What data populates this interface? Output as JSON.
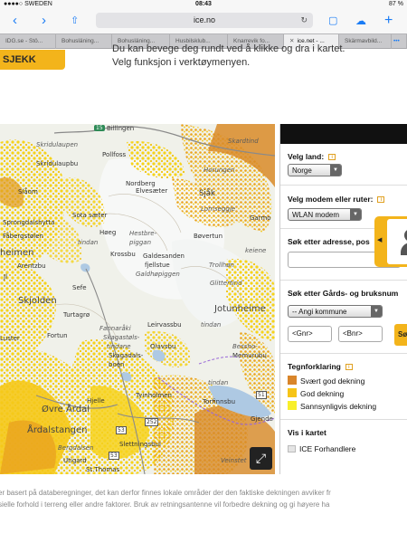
{
  "status_bar": {
    "carrier": "●●●●○ SWEDEN",
    "time": "08:43",
    "battery": "87 %"
  },
  "browser": {
    "url": "ice.no",
    "tabs": [
      {
        "label": "IDG.se - Stö...",
        "active": false
      },
      {
        "label": "Bohusläning...",
        "active": false
      },
      {
        "label": "Bohusläning...",
        "active": false
      },
      {
        "label": "Husbilsklub...",
        "active": false
      },
      {
        "label": "Knarrevik fo...",
        "active": false
      },
      {
        "label": "ice.net - ...",
        "active": true
      },
      {
        "label": "Skärmavbild...",
        "active": false
      }
    ],
    "more_tabs": "•••"
  },
  "page": {
    "sjekk_button": "SJEKK",
    "intro_line1": "Du kan bevege deg rundt ved å klikke og dra i kartet.",
    "intro_line2": "Velg funksjon i verktøymenyen."
  },
  "map": {
    "labels": {
      "billingen": "Billingen",
      "skridulaupen": "Skridulaupen",
      "pollfoss": "Pollfoss",
      "skridulaupbu": "Skridulaupbu",
      "slaom": "Slåom",
      "nordberg": "Nordberg",
      "elvesaeter": "Elvesæter",
      "skardtind": "Skardtind",
      "horungen": "Horungen",
      "sjak": "Sjåk",
      "lomseggje": "Lomseggje",
      "garmo": "Garmo",
      "sota_saeter": "Sota sæter",
      "sprongdal": "Sprongdalshytta",
      "faberg": "Fåbergstølen",
      "hoeg": "Høeg",
      "tindan": "tindan",
      "hestbrep": "Hestbre-",
      "piggan": "piggan",
      "bovertun": "Bøvertun",
      "krossbu": "Krossbu",
      "heimen": "heimen",
      "gaklsanden": "Galdesanden",
      "fjellstue": "fjellstue",
      "galdhopiggen": "Galdhøpiggen",
      "trollhon": "Trollhøn",
      "keiene": "keiene",
      "arentzbu": "Arentzbu",
      "ji": "Jl",
      "sefe": "Sefe",
      "glittertind": "Glittertind",
      "skjolden": "Skjolden",
      "turtagro": "Turtagrø",
      "fannaraki": "Fannaråki",
      "skagastol": "Skagastøls-",
      "tindane": "tindane",
      "leirvassbu": "Leirvassbu",
      "tindan2": "tindan",
      "jotunheime": "Jotunheime",
      "luster": "Luster",
      "fortun": "Fortun",
      "skagadals": "Skagadals-",
      "boen": "boen",
      "olavsbu": "Olavsbu",
      "besshole": "Bessho-",
      "memurubu": "Memurubu",
      "hjelle": "Hjelle",
      "tyinholmen": "Tyinholmen",
      "torfinnsbu": "Torfinnsbu",
      "ovre_ardal": "Øvre Årdal",
      "ardalstangen": "Årdalstangen",
      "gjende": "Gjende",
      "slettningsbu": "Slettningsbui",
      "bergdalsen": "Bergdalsen",
      "sthomas": "St.Thomas",
      "utigard": "Utigard",
      "vettisfossen": "Vetti",
      "tindan3": "tindan",
      "veinstet": "Veinstet",
      "rd15": "15",
      "rd51": "51",
      "rd53": "53",
      "rd252": "252",
      "rd53b": "53"
    },
    "expand_icon": "⤢"
  },
  "panel": {
    "velg_land": "Velg land:",
    "land_value": "Norge",
    "velg_modem": "Velg modem eller ruter:",
    "modem_value": "WLAN modem",
    "sok_adresse": "Søk etter adresse, pos",
    "sok_gard": "Søk etter Gårds- og bruksnum",
    "kommune_value": "-- Angi kommune",
    "gnr_placeholder": "<Gnr>",
    "bnr_placeholder": "<Bnr>",
    "sok_button": "Sø",
    "tegnforklaring": "Tegnforklaring",
    "legend": [
      {
        "label": "Svært god dekning",
        "color": "#d9852a"
      },
      {
        "label": "God dekning",
        "color": "#f6c417"
      },
      {
        "label": "Sannsynligvis dekning",
        "color": "#f8ef2a"
      }
    ],
    "vis_i_kartet": "Vis i kartet",
    "ice_forhandlere": "ICE Forhandlere",
    "info_icon": "i"
  },
  "footer": {
    "line1": "er basert på databeregninger, det kan derfor finnes lokale områder der den faktiske dekningen avviker fr",
    "line2": "sielle forhold i terreng eller andre faktorer. Bruk av retningsantenne vil forbedre dekning og gi høyere ha"
  },
  "colors": {
    "accent": "#f3b41b",
    "ios_blue": "#1a7cf5",
    "panel_header": "#111111"
  }
}
